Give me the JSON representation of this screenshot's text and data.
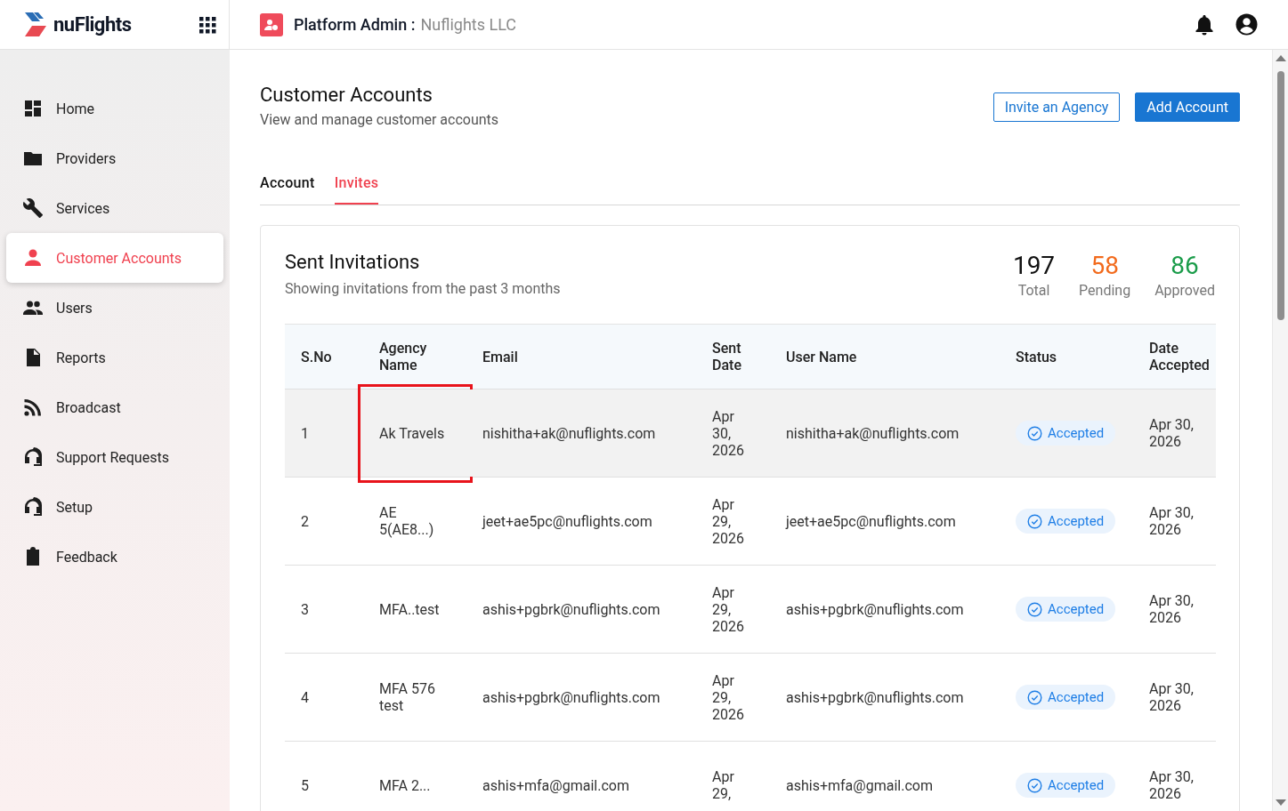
{
  "header": {
    "brand": "nuFlights",
    "title": "Platform Admin :",
    "org": "Nuflights LLC"
  },
  "sidebar": {
    "items": [
      {
        "label": "Home",
        "kind": "dashboard",
        "selected": false
      },
      {
        "label": "Providers",
        "kind": "folder",
        "selected": false
      },
      {
        "label": "Services",
        "kind": "wrench",
        "selected": false
      },
      {
        "label": "Customer Accounts",
        "kind": "person",
        "selected": true
      },
      {
        "label": "Users",
        "kind": "people",
        "selected": false
      },
      {
        "label": "Reports",
        "kind": "document",
        "selected": false
      },
      {
        "label": "Broadcast",
        "kind": "rss",
        "selected": false
      },
      {
        "label": "Support Requests",
        "kind": "headset",
        "selected": false
      },
      {
        "label": "Setup",
        "kind": "headset",
        "selected": false
      },
      {
        "label": "Feedback",
        "kind": "clipboard",
        "selected": false
      }
    ]
  },
  "page": {
    "title": "Customer Accounts",
    "subtitle": "View and manage customer accounts",
    "buttons": [
      {
        "label": "Invite an Agency",
        "kind": "outline"
      },
      {
        "label": "Add Account",
        "kind": "primary"
      }
    ]
  },
  "tabs": [
    {
      "label": "Account",
      "selected": false
    },
    {
      "label": "Invites",
      "selected": true
    }
  ],
  "card": {
    "title": "Sent Invitations",
    "subtitle": "Showing invitations from the past 3 months",
    "stats": [
      {
        "value": "197",
        "label": "Total",
        "color": "#111111"
      },
      {
        "value": "58",
        "label": "Pending",
        "color": "#f26b1d"
      },
      {
        "value": "86",
        "label": "Approved",
        "color": "#1b9c4a"
      }
    ]
  },
  "table": {
    "columns": [
      "S.No",
      "Agency Name",
      "Email",
      "Sent Date",
      "User Name",
      "Status",
      "Date Accepted"
    ],
    "rows": [
      {
        "sno": "1",
        "agency": "Ak Travels",
        "email": "nishitha+ak@nuflights.com",
        "sent_date": "Apr 30, 2026",
        "user_name": "nishitha+ak@nuflights.com",
        "status": "Accepted",
        "date_accepted": "Apr 30, 2026",
        "highlighted": true
      },
      {
        "sno": "2",
        "agency": "AE 5(AE8...)",
        "email": "jeet+ae5pc@nuflights.com",
        "sent_date": "Apr 29, 2026",
        "user_name": "jeet+ae5pc@nuflights.com",
        "status": "Accepted",
        "date_accepted": "Apr 30, 2026",
        "highlighted": false
      },
      {
        "sno": "3",
        "agency": "MFA..test",
        "email": "ashis+pgbrk@nuflights.com",
        "sent_date": "Apr 29, 2026",
        "user_name": "ashis+pgbrk@nuflights.com",
        "status": "Accepted",
        "date_accepted": "Apr 30, 2026",
        "highlighted": false
      },
      {
        "sno": "4",
        "agency": "MFA 576 test",
        "email": "ashis+pgbrk@nuflights.com",
        "sent_date": "Apr 29, 2026",
        "user_name": "ashis+pgbrk@nuflights.com",
        "status": "Accepted",
        "date_accepted": "Apr 30, 2026",
        "highlighted": false
      },
      {
        "sno": "5",
        "agency": "MFA 2...",
        "email": "ashis+mfa@gmail.com",
        "sent_date": "Apr 29,",
        "user_name": "ashis+mfa@gmail.com",
        "status": "Accepted",
        "date_accepted": "Apr 30, 2026",
        "highlighted": false
      }
    ]
  }
}
